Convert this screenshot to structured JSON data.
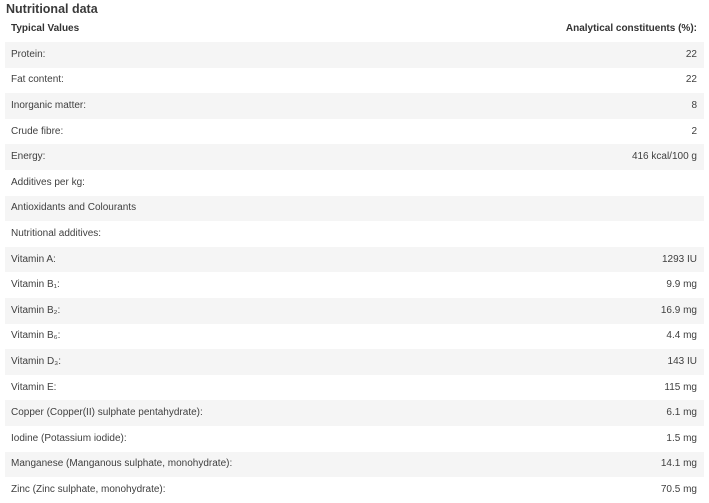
{
  "section": {
    "title": "Nutritional data"
  },
  "table": {
    "headers": [
      "Typical Values",
      "Analytical constituents (%):"
    ],
    "rows": [
      {
        "label": "Protein:",
        "value": "22"
      },
      {
        "label": "Fat content:",
        "value": "22"
      },
      {
        "label": "Inorganic matter:",
        "value": "8"
      },
      {
        "label": "Crude fibre:",
        "value": "2"
      },
      {
        "label": "Energy:",
        "value": "416 kcal/100 g"
      },
      {
        "label": "Additives per kg:",
        "value": ""
      },
      {
        "label": "Antioxidants and Colourants",
        "value": ""
      },
      {
        "label": "Nutritional additives:",
        "value": ""
      },
      {
        "label": "Vitamin A:",
        "value": "1293 IU"
      },
      {
        "label": "Vitamin B₁:",
        "value": "9.9 mg"
      },
      {
        "label": "Vitamin B₂:",
        "value": "16.9 mg"
      },
      {
        "label": "Vitamin B₆:",
        "value": "4.4 mg"
      },
      {
        "label": "Vitamin D₃:",
        "value": "143 IU"
      },
      {
        "label": "Vitamin E:",
        "value": "115 mg"
      },
      {
        "label": "Copper (Copper(II) sulphate pentahydrate):",
        "value": "6.1 mg"
      },
      {
        "label": "Iodine (Potassium iodide):",
        "value": "1.5 mg"
      },
      {
        "label": "Manganese (Manganous sulphate, monohydrate):",
        "value": "14.1 mg"
      },
      {
        "label": "Zinc (Zinc sulphate, monohydrate):",
        "value": "70.5 mg"
      }
    ]
  },
  "colors": {
    "row_stripe": "#f5f5f5",
    "text": "#3f3f3f",
    "background": "#ffffff"
  }
}
